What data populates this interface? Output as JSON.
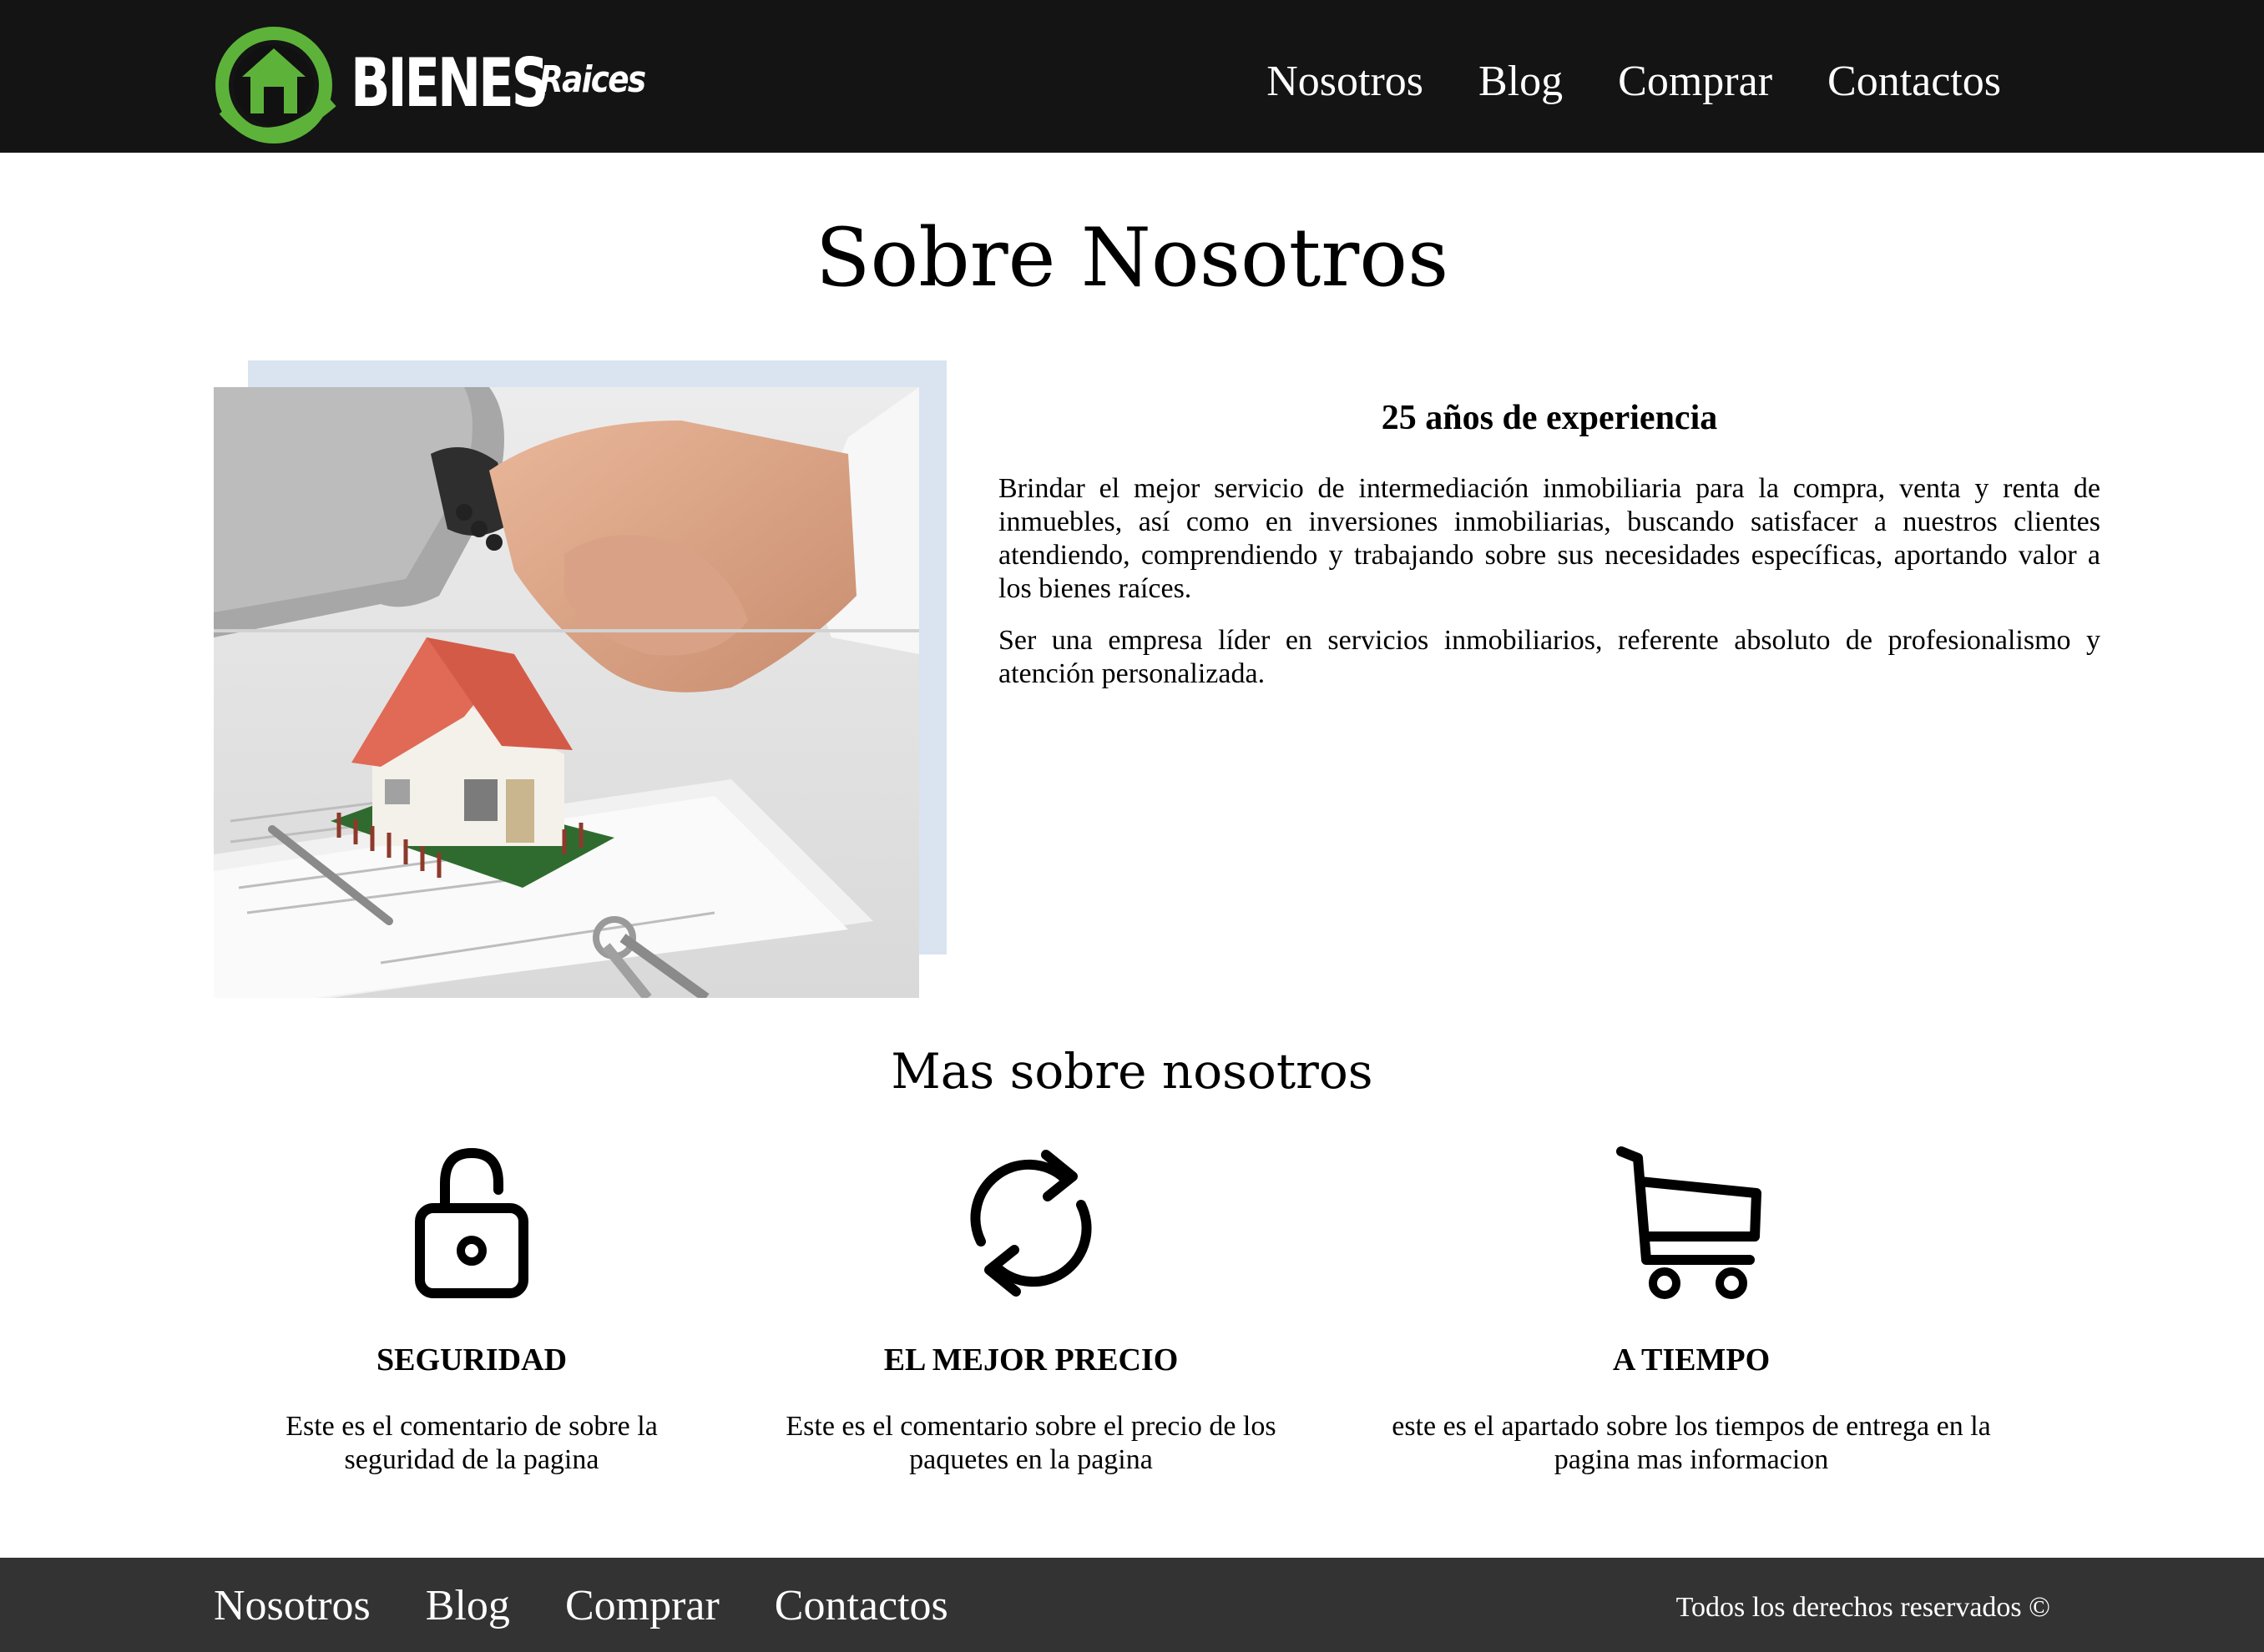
{
  "header": {
    "logo_main": "BIENES",
    "logo_sub": "Raices",
    "nav": [
      "Nosotros",
      "Blog",
      "Comprar",
      "Contactos"
    ]
  },
  "main": {
    "title": "Sobre Nosotros",
    "about": {
      "heading": "25 años de experiencia",
      "paragraphs": [
        "Brindar el mejor servicio de intermediación inmobiliaria para la compra, venta y renta de inmuebles, así como en inversiones inmobiliarias, buscando satisfacer a nuestros clientes atendiendo, comprendiendo y trabajando sobre sus necesidades específicas, aportando valor a los bienes raíces.",
        "Ser una empresa líder en servicios inmobiliarios, referente absoluto de profesionalismo y atención personalizada."
      ]
    },
    "more": {
      "title": "Mas sobre nosotros",
      "features": [
        {
          "icon": "lock-icon",
          "title": "SEGURIDAD",
          "text": "Este es el comentario de sobre la seguridad de la pagina"
        },
        {
          "icon": "refresh-icon",
          "title": "EL MEJOR PRECIO",
          "text": "Este es el comentario sobre el precio de los paquetes en la pagina"
        },
        {
          "icon": "shopping-cart-icon",
          "title": "A TIEMPO",
          "text": "este es el apartado sobre los tiempos de entrega en la pagina mas informacion"
        }
      ]
    }
  },
  "footer": {
    "nav": [
      "Nosotros",
      "Blog",
      "Comprar",
      "Contactos"
    ],
    "copyright": "Todos los derechos reservados ©"
  },
  "colors": {
    "header_bg": "#141414",
    "footer_bg": "#333333",
    "logo_green": "#5db33a",
    "image_accent": "#d9e4f0"
  }
}
